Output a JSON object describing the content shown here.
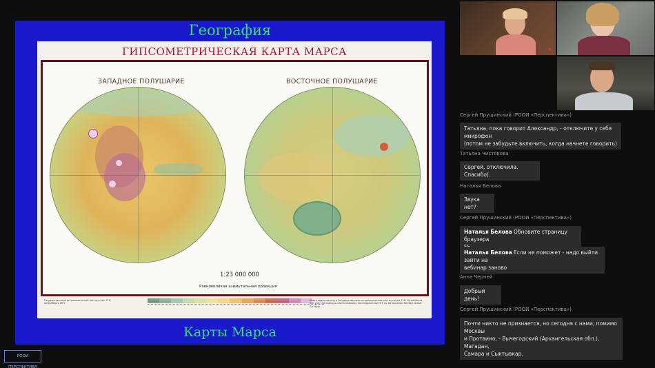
{
  "slide": {
    "title": "География",
    "caption": "Карты Марса",
    "map": {
      "heading": "ГИПСОМЕТРИЧЕСКАЯ КАРТА МАРСА",
      "west_label": "ЗАПАДНОЕ ПОЛУШАРИЕ",
      "east_label": "ВОСТОЧНОЕ ПОЛУШАРИЕ",
      "scale": "1:23 000 000",
      "projection": "Равновеликая азимутальная проекция",
      "legend_colors": [
        "#7d9a82",
        "#8fb39a",
        "#a6c9ad",
        "#c3dcae",
        "#d9e29f",
        "#ece3a0",
        "#f0d88c",
        "#eec173",
        "#e5a65f",
        "#d88c57",
        "#c9705a",
        "#c06a87",
        "#c98fb8",
        "#ddb8d8",
        "#efe4f0"
      ],
      "note_left": "Государственный астрономический институт им. П.К. Штернберга МГУ",
      "note_right": "Карта подготовлена в Государственном астрономическом институте им. П.К. Штернберга при участии кафедры картографии и геоинформатики МГУ по материалам КА Mars Global Surveyor"
    }
  },
  "watermark": "РООИ ПЕРСПЕКТИВА",
  "videos": {
    "mic_icon": "mic-off-icon"
  },
  "chat": [
    {
      "author": "Сергей Прушинский (РООИ «Перспектива»)",
      "lines": [
        "Татьяна, пока говорит Александр, - отключите у себя микрофон",
        "(потом не забудьте включить, когда начнете говорить)"
      ]
    },
    {
      "author": "Татьяна Чистякова",
      "lines": [
        "Сергей, отключила. Спасибо(."
      ]
    },
    {
      "author": "Наталья Белова",
      "lines": [
        "Звука нет?"
      ]
    },
    {
      "author": "Сергей Прушинский (РООИ «Перспектива»)",
      "mentions": [
        {
          "name": "Наталья Белова",
          "lines": [
            " Обновите страницу браузера",
            "F5"
          ]
        },
        {
          "name": "Наталья Белова",
          "lines": [
            " Если не поможет - надо выйти зайти на",
            "вебинар заново"
          ]
        }
      ]
    },
    {
      "author": "Анна Черней",
      "lines": [
        "Добрый день!"
      ]
    },
    {
      "author": "Сергей Прушинский (РООИ «Перспектива»)",
      "lines": [
        "Почти никто не признается, но сегодня с нами, помимо Москвы",
        "и Протвино, - Вычегодский (Архангельская обл.), Магадан,",
        "Самара и Сыктывкар."
      ]
    }
  ]
}
